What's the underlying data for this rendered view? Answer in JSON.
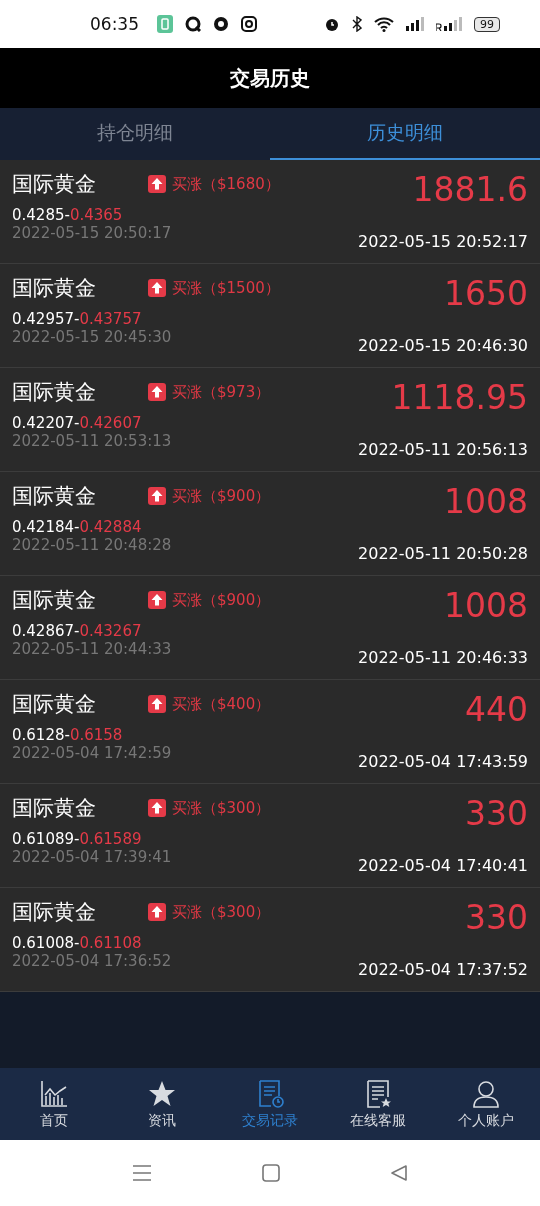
{
  "status_bar": {
    "time": "06:35",
    "battery": "99"
  },
  "header": {
    "title": "交易历史"
  },
  "tabs": [
    {
      "label": "持仓明细",
      "selected": false
    },
    {
      "label": "历史明细",
      "selected": true
    }
  ],
  "trades": [
    {
      "name": "国际黄金",
      "kind": "up",
      "badge": "买涨（$1680）",
      "price_from": "0.4285-",
      "price_to": "0.4365",
      "open_time": "2022-05-15 20:50:17",
      "amount": "1881.6",
      "close_time": "2022-05-15 20:52:17"
    },
    {
      "name": "国际黄金",
      "kind": "up",
      "badge": "买涨（$1500）",
      "price_from": "0.42957-",
      "price_to": "0.43757",
      "open_time": "2022-05-15 20:45:30",
      "amount": "1650",
      "close_time": "2022-05-15 20:46:30"
    },
    {
      "name": "国际黄金",
      "kind": "up",
      "badge": "买涨（$973）",
      "price_from": "0.42207-",
      "price_to": "0.42607",
      "open_time": "2022-05-11 20:53:13",
      "amount": "1118.95",
      "close_time": "2022-05-11 20:56:13"
    },
    {
      "name": "国际黄金",
      "kind": "up",
      "badge": "买涨（$900）",
      "price_from": "0.42184-",
      "price_to": "0.42884",
      "open_time": "2022-05-11 20:48:28",
      "amount": "1008",
      "close_time": "2022-05-11 20:50:28"
    },
    {
      "name": "国际黄金",
      "kind": "up",
      "badge": "买涨（$900）",
      "price_from": "0.42867-",
      "price_to": "0.43267",
      "open_time": "2022-05-11 20:44:33",
      "amount": "1008",
      "close_time": "2022-05-11 20:46:33"
    },
    {
      "name": "国际黄金",
      "kind": "up",
      "badge": "买涨（$400）",
      "price_from": "0.6128-",
      "price_to": "0.6158",
      "open_time": "2022-05-04 17:42:59",
      "amount": "440",
      "close_time": "2022-05-04 17:43:59"
    },
    {
      "name": "国际黄金",
      "kind": "up",
      "badge": "买涨（$300）",
      "price_from": "0.61089-",
      "price_to": "0.61589",
      "open_time": "2022-05-04 17:39:41",
      "amount": "330",
      "close_time": "2022-05-04 17:40:41"
    },
    {
      "name": "国际黄金",
      "kind": "up",
      "badge": "买涨（$300）",
      "price_from": "0.61008-",
      "price_to": "0.61108",
      "open_time": "2022-05-04 17:36:52",
      "amount": "330",
      "close_time": "2022-05-04 17:37:52"
    }
  ],
  "bottom_nav": [
    {
      "kind": "home",
      "label": "首页",
      "selected": false
    },
    {
      "kind": "news",
      "label": "资讯",
      "selected": false
    },
    {
      "kind": "records",
      "label": "交易记录",
      "selected": true
    },
    {
      "kind": "service",
      "label": "在线客服",
      "selected": false
    },
    {
      "kind": "account",
      "label": "个人账户",
      "selected": false
    }
  ]
}
